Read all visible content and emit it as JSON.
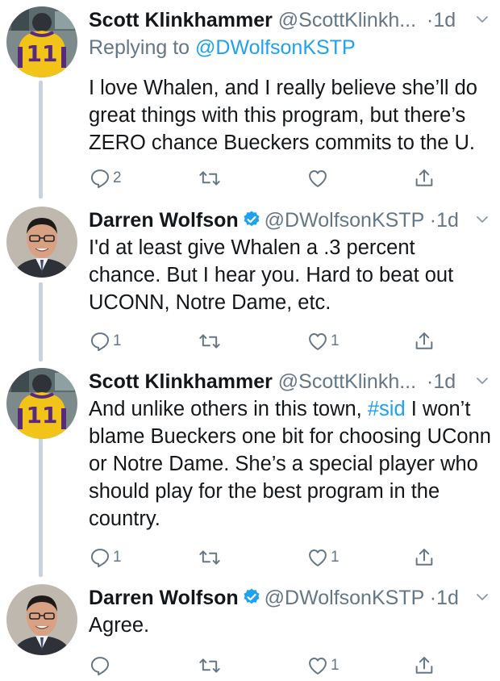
{
  "colors": {
    "link": "#1da1f2",
    "muted": "#657786",
    "text": "#14171a",
    "verified": "#1da1f2",
    "thread_line": "#c9d3db"
  },
  "tweets": [
    {
      "name": "Scott Klinkhammer",
      "handle": "@ScottKlinkh...",
      "dot": "·",
      "time": "1d",
      "verified": false,
      "avatar": "jersey-11-avatar",
      "replying_prefix": "Replying to ",
      "replying_handle": "@DWolfsonKSTP",
      "text": "I love Whalen, and I really believe she’ll do great things with this program, but there’s ZERO chance Bueckers commits to the U.",
      "reply_count": "2",
      "retweet_count": "",
      "like_count": ""
    },
    {
      "name": "Darren Wolfson",
      "handle": "@DWolfsonKSTP",
      "dot": "·",
      "time": "1d",
      "verified": true,
      "avatar": "man-portrait-avatar",
      "text": "I'd at least give Whalen a .3 percent chance. But I hear you. Hard to beat out UCONN, Notre Dame, etc.",
      "reply_count": "1",
      "retweet_count": "",
      "like_count": "1"
    },
    {
      "name": "Scott Klinkhammer",
      "handle": "@ScottKlinkh...",
      "dot": "·",
      "time": "1d",
      "verified": false,
      "avatar": "jersey-11-avatar",
      "text_before": "And unlike others in this town, ",
      "hashtag": "#sid",
      "text_after": " I won’t blame Bueckers one bit for choosing UConn or Notre Dame. She’s a special player who should play for the best program in the country.",
      "reply_count": "1",
      "retweet_count": "",
      "like_count": "1"
    },
    {
      "name": "Darren Wolfson",
      "handle": "@DWolfsonKSTP",
      "dot": "·",
      "time": "1d",
      "verified": true,
      "avatar": "man-portrait-avatar",
      "text": "Agree.",
      "reply_count": "",
      "retweet_count": "",
      "like_count": "1"
    }
  ],
  "jersey_number": "11"
}
